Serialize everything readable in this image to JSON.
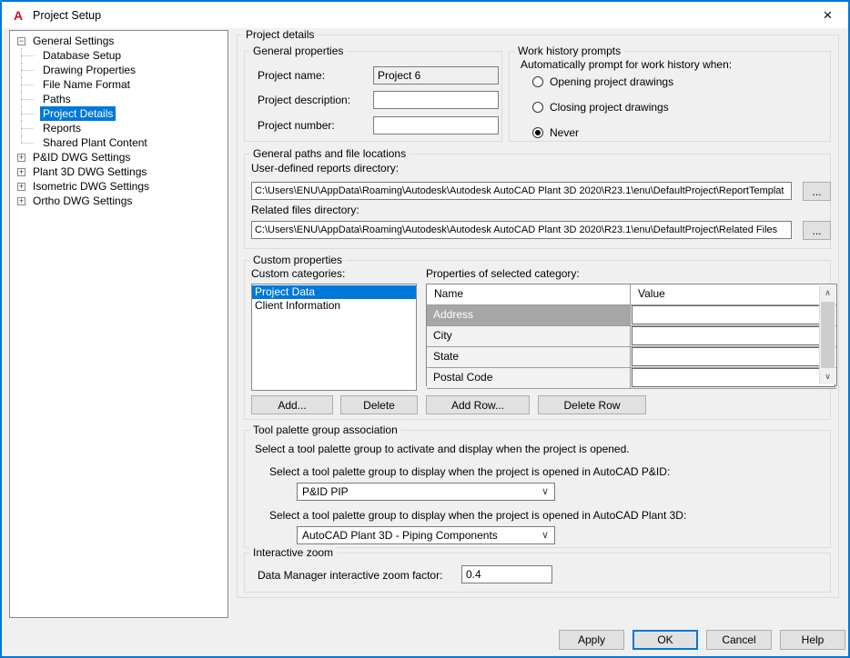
{
  "window": {
    "title": "Project Setup",
    "logo_letter": "A"
  },
  "icons": {
    "close": "×",
    "combo_chevron": "∨",
    "scroll_up": "∧",
    "scroll_down": "∨",
    "expand_plus": "+",
    "collapse_minus": "−"
  },
  "tree": {
    "items": [
      {
        "label": "General Settings",
        "glyph": "−",
        "level": 0,
        "selected": false
      },
      {
        "label": "Database Setup",
        "level": 1,
        "selected": false
      },
      {
        "label": "Drawing Properties",
        "level": 1,
        "selected": false
      },
      {
        "label": "File Name Format",
        "level": 1,
        "selected": false
      },
      {
        "label": "Paths",
        "level": 1,
        "selected": false
      },
      {
        "label": "Project Details",
        "level": 1,
        "selected": true
      },
      {
        "label": "Reports",
        "level": 1,
        "selected": false
      },
      {
        "label": "Shared Plant Content",
        "level": 1,
        "selected": false
      },
      {
        "label": "P&ID DWG Settings",
        "glyph": "+",
        "level": 0,
        "selected": false
      },
      {
        "label": "Plant 3D DWG Settings",
        "glyph": "+",
        "level": 0,
        "selected": false
      },
      {
        "label": "Isometric DWG Settings",
        "glyph": "+",
        "level": 0,
        "selected": false
      },
      {
        "label": "Ortho DWG Settings",
        "glyph": "+",
        "level": 0,
        "selected": false
      }
    ]
  },
  "panel": {
    "title": "Project details",
    "general_properties": {
      "title": "General properties",
      "project_name_label": "Project name:",
      "project_name_value": "Project 6",
      "project_description_label": "Project description:",
      "project_description_value": "",
      "project_number_label": "Project number:",
      "project_number_value": ""
    },
    "work_history": {
      "title": "Work history prompts",
      "prompt_label": "Automatically prompt for work history when:",
      "options": [
        {
          "label": "Opening project drawings",
          "selected": false
        },
        {
          "label": "Closing project drawings",
          "selected": false
        },
        {
          "label": "Never",
          "selected": true
        }
      ]
    },
    "paths": {
      "title": "General paths and file locations",
      "reports_label": "User-defined reports directory:",
      "reports_value": "C:\\Users\\ENU\\AppData\\Roaming\\Autodesk\\Autodesk AutoCAD Plant 3D 2020\\R23.1\\enu\\DefaultProject\\ReportTemplat",
      "related_label": "Related files directory:",
      "related_value": "C:\\Users\\ENU\\AppData\\Roaming\\Autodesk\\Autodesk AutoCAD Plant 3D 2020\\R23.1\\enu\\DefaultProject\\Related Files",
      "browse_label": "..."
    },
    "custom_properties": {
      "title": "Custom properties",
      "categories_label": "Custom categories:",
      "categories": [
        {
          "label": "Project Data",
          "selected": true
        },
        {
          "label": "Client Information",
          "selected": false
        }
      ],
      "table_label": "Properties of selected category:",
      "columns": [
        "Name",
        "Value"
      ],
      "rows": [
        {
          "name": "Address",
          "value": "",
          "selected": true
        },
        {
          "name": "City",
          "value": "",
          "selected": false
        },
        {
          "name": "State",
          "value": "",
          "selected": false
        },
        {
          "name": "Postal Code",
          "value": "",
          "selected": false
        }
      ],
      "buttons": {
        "add": "Add...",
        "delete": "Delete",
        "add_row": "Add Row...",
        "delete_row": "Delete Row"
      }
    },
    "tool_palette": {
      "title": "Tool palette group association",
      "intro": "Select a tool palette group to activate and display when the project is opened.",
      "pid_label": "Select a tool palette group to display when the project is opened in AutoCAD P&ID:",
      "pid_value": "P&ID PIP",
      "plant3d_label": "Select a tool palette group to display when the project is opened in AutoCAD Plant 3D:",
      "plant3d_value": "AutoCAD Plant 3D - Piping Components"
    },
    "interactive_zoom": {
      "title": "Interactive zoom",
      "factor_label": "Data Manager interactive zoom factor:",
      "factor_value": "0.4"
    }
  },
  "footer": {
    "apply": "Apply",
    "ok": "OK",
    "cancel": "Cancel",
    "help": "Help"
  },
  "colors": {
    "accent": "#0078d7",
    "selected_row": "#a6a6a6",
    "titlebar": "#ffffff",
    "dialog_bg": "#f0f0f0"
  }
}
